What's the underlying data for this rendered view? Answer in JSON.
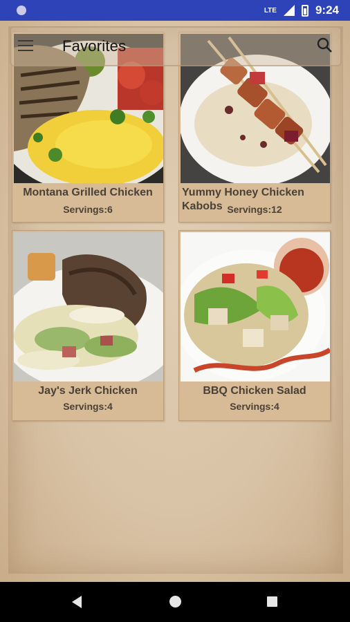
{
  "status_bar": {
    "network": "LTE",
    "time": "9:24"
  },
  "app_bar": {
    "title": "Favorites"
  },
  "recipes": [
    {
      "name": "Montana Grilled Chicken",
      "servings": "Servings:6"
    },
    {
      "name": "Yummy Honey Chicken Kabobs",
      "servings": "Servings:12"
    },
    {
      "name": "Jay's Jerk Chicken",
      "servings": "Servings:4"
    },
    {
      "name": "BBQ Chicken Salad",
      "servings": "Servings:4"
    }
  ],
  "colors": {
    "status_bar": "#2f43b8",
    "paper": "#d9c3a6",
    "card": "#d7bb97",
    "text": "#4a4036"
  }
}
